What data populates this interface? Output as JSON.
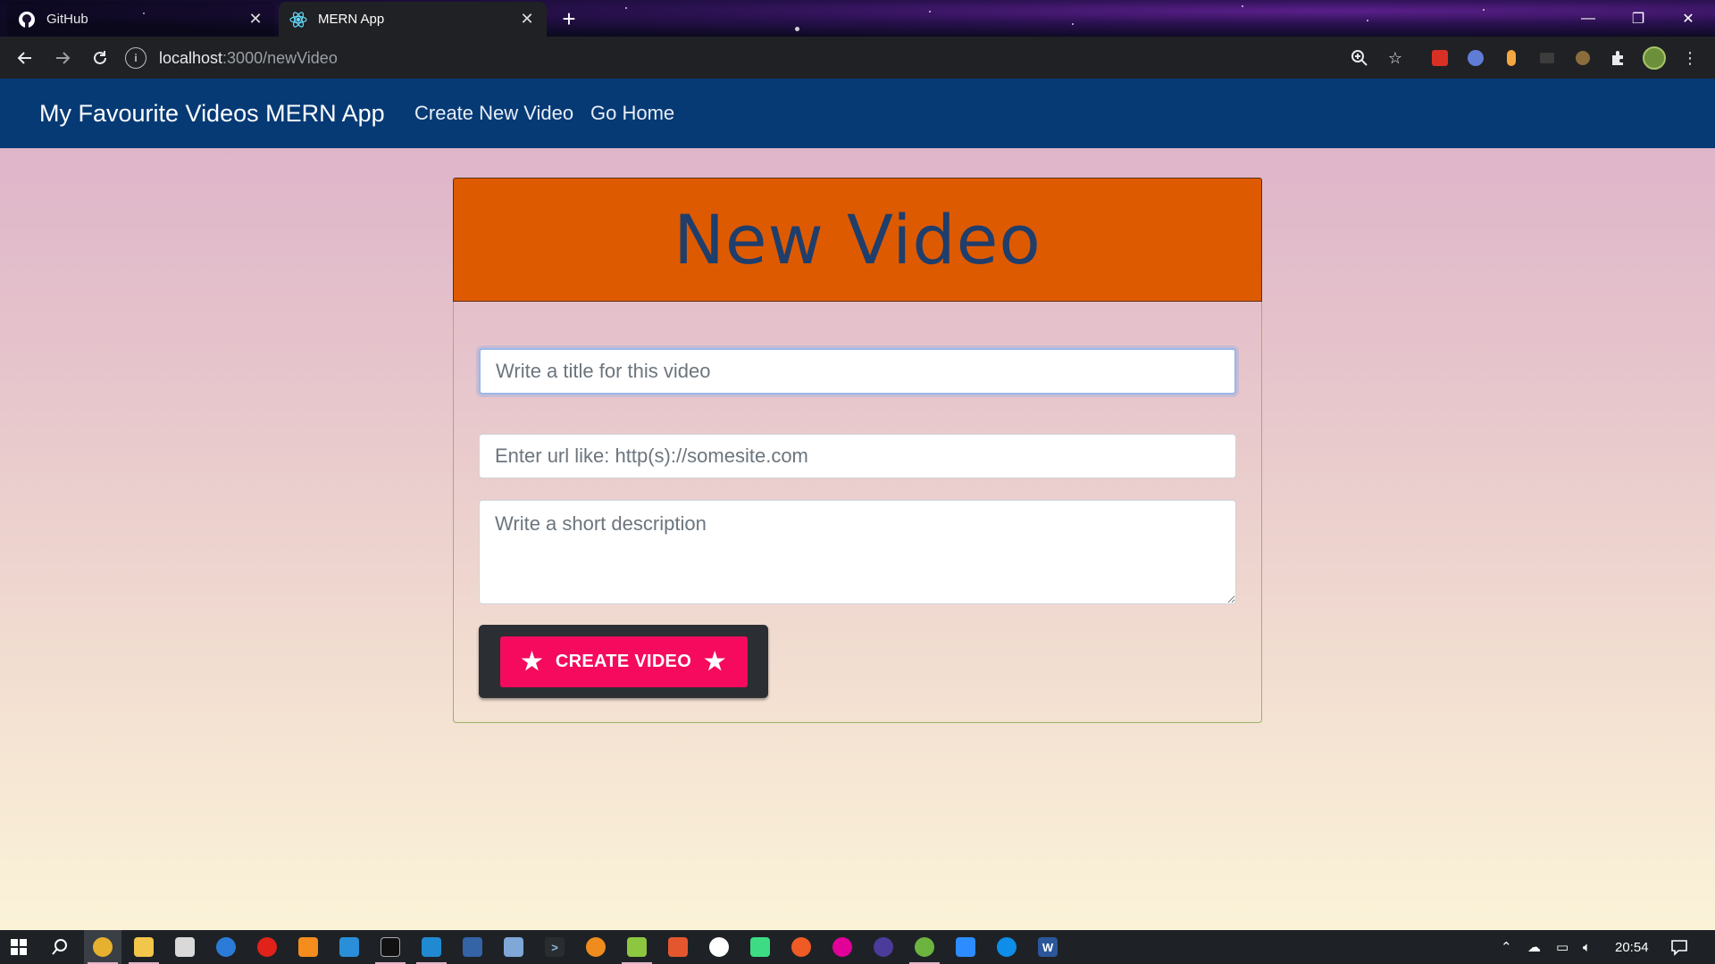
{
  "browser": {
    "tabs": [
      {
        "title": "GitHub",
        "icon": "github-icon",
        "active": false
      },
      {
        "title": "MERN App",
        "icon": "react-icon",
        "active": true
      }
    ],
    "url_host": "localhost",
    "url_path": ":3000/newVideo"
  },
  "app": {
    "brand": "My Favourite Videos MERN App",
    "nav": [
      "Create New Video",
      "Go Home"
    ],
    "header": "New Video",
    "form": {
      "title_placeholder": "Write a title for this video",
      "url_placeholder": "Enter url like: http(s)://somesite.com",
      "description_placeholder": "Write a short description",
      "submit_label": "CREATE VIDEO"
    },
    "colors": {
      "navbar": "#063a75",
      "header": "#de5a00",
      "button": "#f50a5d"
    }
  },
  "taskbar": {
    "clock": "20:54"
  }
}
